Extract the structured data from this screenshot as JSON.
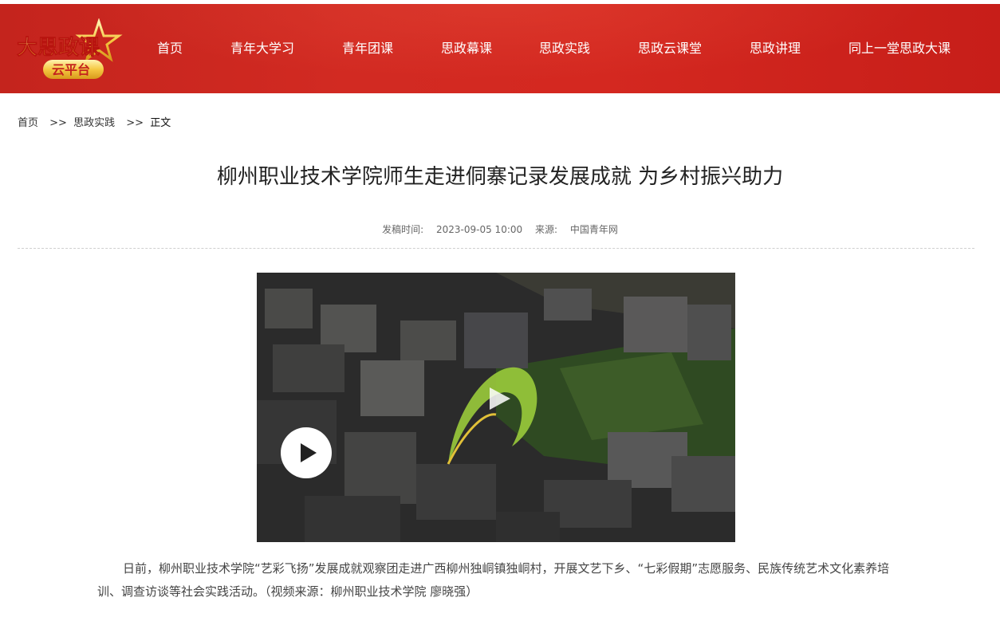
{
  "header": {
    "logo": {
      "main_text": "大思政课",
      "sub_text": "云平台"
    },
    "nav": [
      {
        "label": "首页"
      },
      {
        "label": "青年大学习"
      },
      {
        "label": "青年团课"
      },
      {
        "label": "思政幕课"
      },
      {
        "label": "思政实践"
      },
      {
        "label": "思政云课堂"
      },
      {
        "label": "思政讲理"
      },
      {
        "label": "同上一堂思政大课"
      }
    ],
    "colors": {
      "background": "#d22a22",
      "text": "#ffffff",
      "logo_gold": "#f5c842"
    }
  },
  "breadcrumb": {
    "home": "首页",
    "sep1": ">>",
    "section": "思政实践",
    "sep2": ">>",
    "current": "正文"
  },
  "article": {
    "title": "柳州职业技术学院师生走进侗寨记录发展成就 为乡村振兴助力",
    "meta": {
      "time_label": "发稿时间:",
      "time_value": "2023-09-05 10:00",
      "source_label": "来源:",
      "source_value": "中国青年网"
    },
    "video": {
      "play_icon": "play-icon",
      "watermark": "youth-logo-watermark"
    },
    "paragraph": "日前，柳州职业技术学院“艺彩飞扬”发展成就观察团走进广西柳州独峒镇独峒村，开展文艺下乡、“七彩假期”志愿服务、民族传统艺术文化素养培训、调查访谈等社会实践活动。（视频来源：柳州职业技术学院 廖晓强）"
  }
}
